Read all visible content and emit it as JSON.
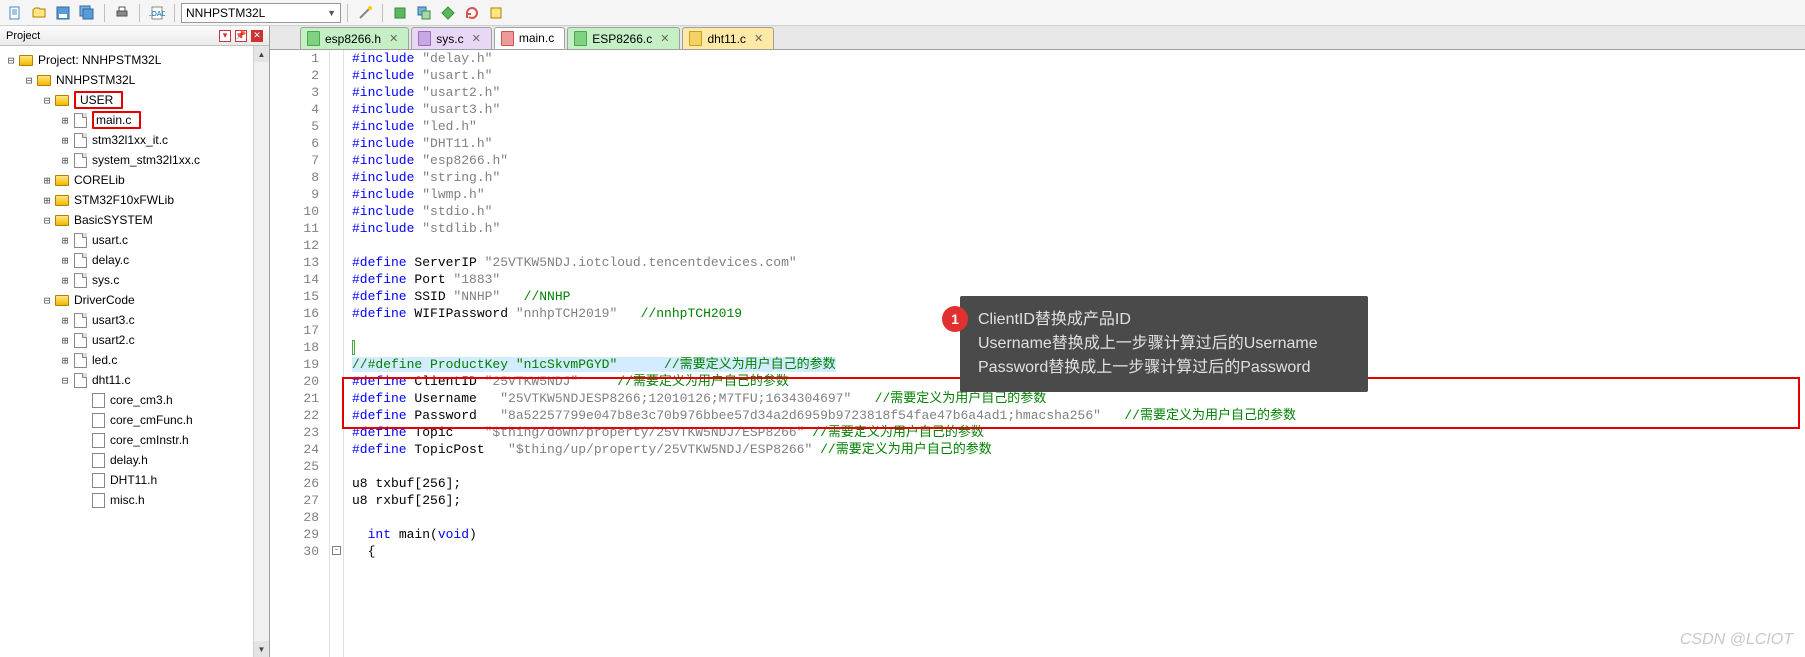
{
  "toolbar": {
    "combo_value": "NNHPSTM32L"
  },
  "project": {
    "title": "Project",
    "root": "Project: NNHPSTM32L",
    "target": "NNHPSTM32L",
    "folders": [
      {
        "name": "USER",
        "files": [
          "main.c",
          "stm32l1xx_it.c",
          "system_stm32l1xx.c"
        ],
        "highlight": true,
        "file_highlights": [
          "main.c"
        ]
      },
      {
        "name": "CORELib",
        "files": []
      },
      {
        "name": "STM32F10xFWLib",
        "files": []
      },
      {
        "name": "BasicSYSTEM",
        "files": [
          "usart.c",
          "delay.c",
          "sys.c"
        ]
      },
      {
        "name": "DriverCode",
        "files": [
          "usart3.c",
          "usart2.c",
          "led.c",
          "dht11.c"
        ],
        "subfiles": {
          "dht11.c": [
            "core_cm3.h",
            "core_cmFunc.h",
            "core_cmInstr.h",
            "delay.h",
            "DHT11.h",
            "misc.h"
          ]
        }
      }
    ]
  },
  "tabs": [
    {
      "label": "esp8266.h",
      "class": "green"
    },
    {
      "label": "sys.c",
      "class": "purple"
    },
    {
      "label": "main.c",
      "class": "red",
      "active": true
    },
    {
      "label": "ESP8266.c",
      "class": "green"
    },
    {
      "label": "dht11.c",
      "class": "yellow"
    }
  ],
  "code": {
    "lines": [
      {
        "n": 1,
        "tokens": [
          [
            "kw-blue",
            "#include"
          ],
          [
            "",
            " "
          ],
          [
            "kw-string",
            "\"delay.h\""
          ]
        ]
      },
      {
        "n": 2,
        "tokens": [
          [
            "kw-blue",
            "#include"
          ],
          [
            "",
            " "
          ],
          [
            "kw-string",
            "\"usart.h\""
          ]
        ]
      },
      {
        "n": 3,
        "tokens": [
          [
            "kw-blue",
            "#include"
          ],
          [
            "",
            " "
          ],
          [
            "kw-string",
            "\"usart2.h\""
          ]
        ]
      },
      {
        "n": 4,
        "tokens": [
          [
            "kw-blue",
            "#include"
          ],
          [
            "",
            " "
          ],
          [
            "kw-string",
            "\"usart3.h\""
          ]
        ]
      },
      {
        "n": 5,
        "tokens": [
          [
            "kw-blue",
            "#include"
          ],
          [
            "",
            " "
          ],
          [
            "kw-string",
            "\"led.h\""
          ]
        ]
      },
      {
        "n": 6,
        "tokens": [
          [
            "kw-blue",
            "#include"
          ],
          [
            "",
            " "
          ],
          [
            "kw-string",
            "\"DHT11.h\""
          ]
        ]
      },
      {
        "n": 7,
        "tokens": [
          [
            "kw-blue",
            "#include"
          ],
          [
            "",
            " "
          ],
          [
            "kw-string",
            "\"esp8266.h\""
          ]
        ]
      },
      {
        "n": 8,
        "tokens": [
          [
            "kw-blue",
            "#include"
          ],
          [
            "",
            " "
          ],
          [
            "kw-string",
            "\"string.h\""
          ]
        ]
      },
      {
        "n": 9,
        "tokens": [
          [
            "kw-blue",
            "#include"
          ],
          [
            "",
            " "
          ],
          [
            "kw-string",
            "\"lwmp.h\""
          ]
        ]
      },
      {
        "n": 10,
        "tokens": [
          [
            "kw-blue",
            "#include"
          ],
          [
            "",
            " "
          ],
          [
            "kw-string",
            "\"stdio.h\""
          ]
        ]
      },
      {
        "n": 11,
        "tokens": [
          [
            "kw-blue",
            "#include"
          ],
          [
            "",
            " "
          ],
          [
            "kw-string",
            "\"stdlib.h\""
          ]
        ]
      },
      {
        "n": 12,
        "tokens": []
      },
      {
        "n": 13,
        "tokens": [
          [
            "kw-blue",
            "#define"
          ],
          [
            "",
            " ServerIP "
          ],
          [
            "kw-string",
            "\"25VTKW5NDJ.iotcloud.tencentdevices.com\""
          ]
        ]
      },
      {
        "n": 14,
        "tokens": [
          [
            "kw-blue",
            "#define"
          ],
          [
            "",
            " Port "
          ],
          [
            "kw-string",
            "\"1883\""
          ]
        ]
      },
      {
        "n": 15,
        "tokens": [
          [
            "kw-blue",
            "#define"
          ],
          [
            "",
            " SSID "
          ],
          [
            "kw-string",
            "\"NNHP\""
          ],
          [
            "",
            "   "
          ],
          [
            "kw-comment",
            "//NNHP"
          ]
        ]
      },
      {
        "n": 16,
        "tokens": [
          [
            "kw-blue",
            "#define"
          ],
          [
            "",
            " WIFIPassword "
          ],
          [
            "kw-string",
            "\"nnhpTCH2019\""
          ],
          [
            "",
            "   "
          ],
          [
            "kw-comment",
            "//nnhpTCH2019"
          ]
        ]
      },
      {
        "n": 17,
        "tokens": []
      },
      {
        "n": 18,
        "tokens": [],
        "cursor": true
      },
      {
        "n": 19,
        "tokens": [
          [
            "kw-comment",
            "//#define ProductKey \"n1cSkvmPGYD\"      //需要定义为用户自己的参数"
          ]
        ],
        "hilite_first": true
      },
      {
        "n": 20,
        "tokens": [
          [
            "kw-blue",
            "#define"
          ],
          [
            "",
            " ClientID "
          ],
          [
            "kw-string",
            "\"25VTKW5NDJ\""
          ],
          [
            "",
            "     "
          ],
          [
            "kw-comment",
            "//需要定义为用户自己的参数"
          ]
        ]
      },
      {
        "n": 21,
        "tokens": [
          [
            "kw-blue",
            "#define"
          ],
          [
            "",
            " Username   "
          ],
          [
            "kw-string",
            "\"25VTKW5NDJESP8266;12010126;M7TFU;1634304697\""
          ],
          [
            "",
            "   "
          ],
          [
            "kw-comment",
            "//需要定义为用户自己的参数"
          ]
        ]
      },
      {
        "n": 22,
        "tokens": [
          [
            "kw-blue",
            "#define"
          ],
          [
            "",
            " Password   "
          ],
          [
            "kw-string",
            "\"8a52257799e047b8e3c70b976bbee57d34a2d6959b9723818f54fae47b6a4ad1;hmacsha256\""
          ],
          [
            "",
            "   "
          ],
          [
            "kw-comment",
            "//需要定义为用户自己的参数"
          ]
        ]
      },
      {
        "n": 23,
        "tokens": [
          [
            "kw-blue",
            "#define"
          ],
          [
            "",
            " Topic    "
          ],
          [
            "kw-string",
            "\"$thing/down/property/25VTKW5NDJ/ESP8266\""
          ],
          [
            "",
            " "
          ],
          [
            "kw-comment",
            "//需要定义为用户自己的参数"
          ]
        ]
      },
      {
        "n": 24,
        "tokens": [
          [
            "kw-blue",
            "#define"
          ],
          [
            "",
            " TopicPost   "
          ],
          [
            "kw-string",
            "\"$thing/up/property/25VTKW5NDJ/ESP8266\""
          ],
          [
            "",
            " "
          ],
          [
            "kw-comment",
            "//需要定义为用户自己的参数"
          ]
        ]
      },
      {
        "n": 25,
        "tokens": []
      },
      {
        "n": 26,
        "tokens": [
          [
            "",
            "u8 txbuf[256];"
          ]
        ]
      },
      {
        "n": 27,
        "tokens": [
          [
            "",
            "u8 rxbuf[256];"
          ]
        ]
      },
      {
        "n": 28,
        "tokens": []
      },
      {
        "n": 29,
        "tokens": [
          [
            "",
            "  "
          ],
          [
            "kw-blue",
            "int"
          ],
          [
            "",
            " main("
          ],
          [
            "kw-blue",
            "void"
          ],
          [
            "",
            ")"
          ]
        ]
      },
      {
        "n": 30,
        "tokens": [
          [
            "",
            "  {"
          ]
        ],
        "outline": true
      }
    ]
  },
  "annotation": {
    "badge": "1",
    "line1": "ClientID替换成产品ID",
    "line2": "Username替换成上一步骤计算过后的Username",
    "line3": "Password替换成上一步骤计算过后的Password"
  },
  "watermark": "CSDN @LCIOT"
}
